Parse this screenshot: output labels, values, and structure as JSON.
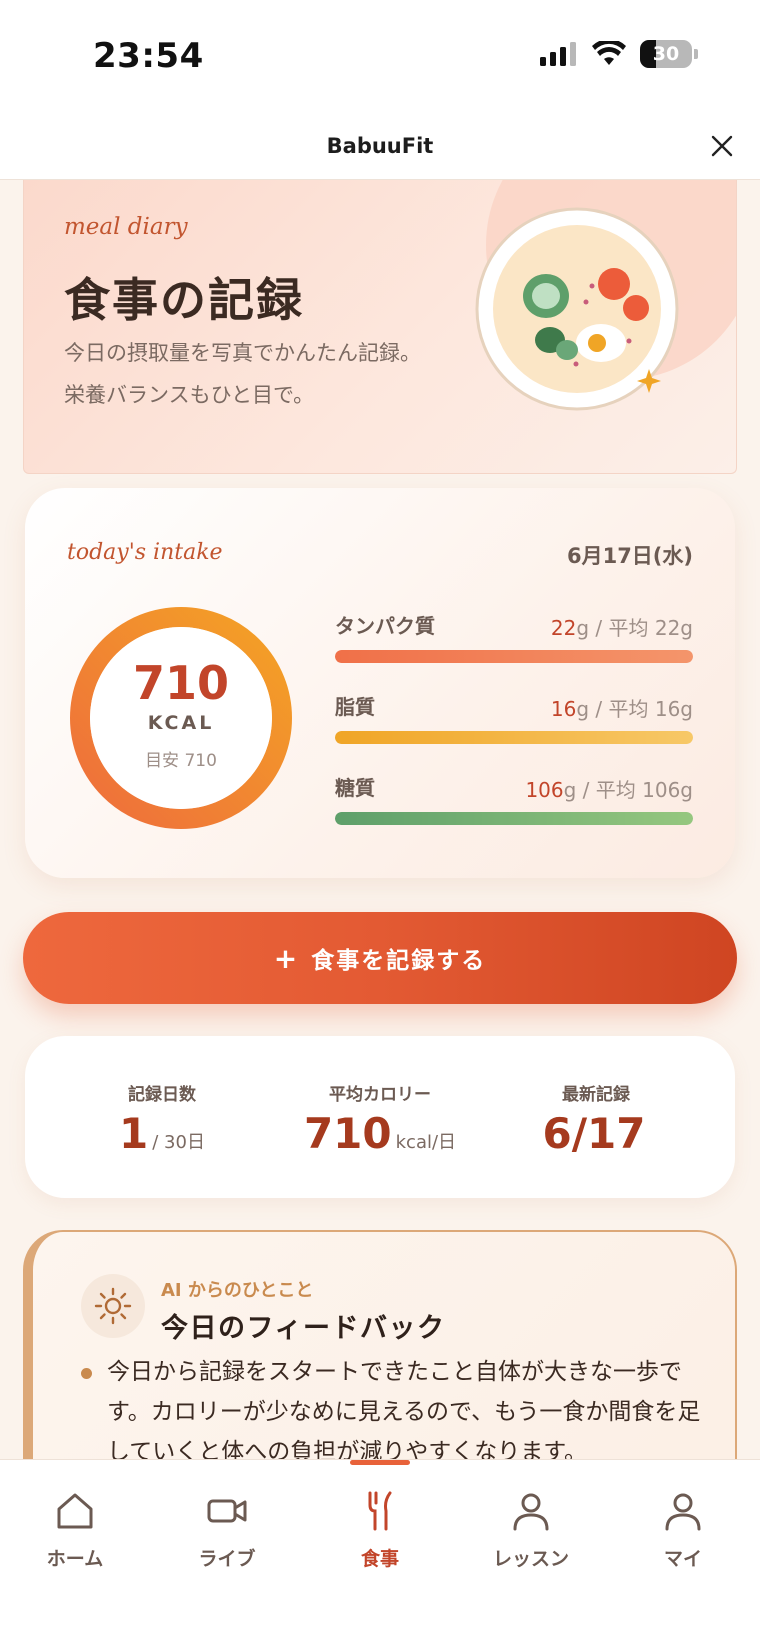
{
  "status_bar": {
    "time": "23:54",
    "battery": "30",
    "battery_level": 0.3
  },
  "header": {
    "title": "BabuuFit"
  },
  "hero": {
    "eyebrow": "meal diary",
    "title": "食事の記録",
    "description": "今日の摂取量を写真でかんたん記録。栄養バランスもひと目で。"
  },
  "intake": {
    "eyebrow": "today's intake",
    "date": "6月17日(水)",
    "calories": "710",
    "unit": "KCAL",
    "target": "目安 710",
    "macros": [
      {
        "name": "タンパク質",
        "value": "22",
        "rest": "g / 平均 22g",
        "fill": 1.0,
        "color_from": "#f07048",
        "color_to": "#f4956b"
      },
      {
        "name": "脂質",
        "value": "16",
        "rest": "g / 平均 16g",
        "fill": 1.0,
        "color_from": "#f0a526",
        "color_to": "#f7c867"
      },
      {
        "name": "糖質",
        "value": "106",
        "rest": "g / 平均 106g",
        "fill": 1.0,
        "color_from": "#5e9f6a",
        "color_to": "#95c77f"
      }
    ]
  },
  "record_button": {
    "plus": "+",
    "label": "食事を記録する"
  },
  "stats": [
    {
      "label": "記録日数",
      "value": "1",
      "suffix": "/ 30日"
    },
    {
      "label": "平均カロリー",
      "value": "710",
      "suffix": "kcal/日"
    },
    {
      "label": "最新記録",
      "value": "6/17",
      "suffix": ""
    }
  ],
  "feedback": {
    "eyebrow": "AI からのひとこと",
    "title": "今日のフィードバック",
    "item": "今日から記録をスタートできたこと自体が大きな一歩です。カロリーが少なめに見えるので、もう一食か間食を足していくと体への負担が減りやすくなります。"
  },
  "nav": [
    {
      "label": "ホーム",
      "icon": "home-icon"
    },
    {
      "label": "ライブ",
      "icon": "video-icon"
    },
    {
      "label": "食事",
      "icon": "utensils-icon",
      "active": true
    },
    {
      "label": "レッスン",
      "icon": "person-icon"
    },
    {
      "label": "マイ",
      "icon": "person-icon"
    }
  ],
  "colors": {
    "accent": "#e35a33",
    "accent_dark": "#c2452a",
    "background": "#fbf3ec"
  }
}
